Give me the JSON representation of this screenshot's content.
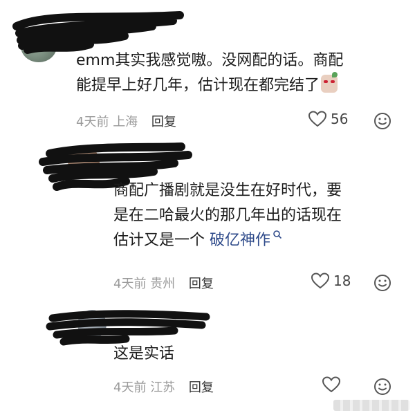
{
  "comments": [
    {
      "lines": [
        "emm其实我感觉嗷。没网配的话。商配",
        "能提早上好几年，估计现在都完结了"
      ],
      "time": "4天前",
      "location": "上海",
      "reply": "回复",
      "likes": "56"
    },
    {
      "lines": [
        "商配广播剧就是没生在好时代，要",
        "是在二哈最火的那几年出的话现在",
        "估计又是一个 "
      ],
      "link": "破亿神作",
      "time": "4天前",
      "location": "贵州",
      "reply": "回复",
      "likes": "18"
    },
    {
      "lines": [
        "这是实话"
      ],
      "time": "4天前",
      "location": "江苏",
      "reply": "回复",
      "likes": ""
    }
  ],
  "icons": {
    "like": "heart-outline-icon",
    "emoji": "smiley-outline-icon",
    "search": "search-icon",
    "sticker": "sticker-emoji"
  },
  "colors": {
    "body_text": "#1c1c1c",
    "meta_text": "#9a9a9a",
    "link": "#2e4a8a"
  }
}
